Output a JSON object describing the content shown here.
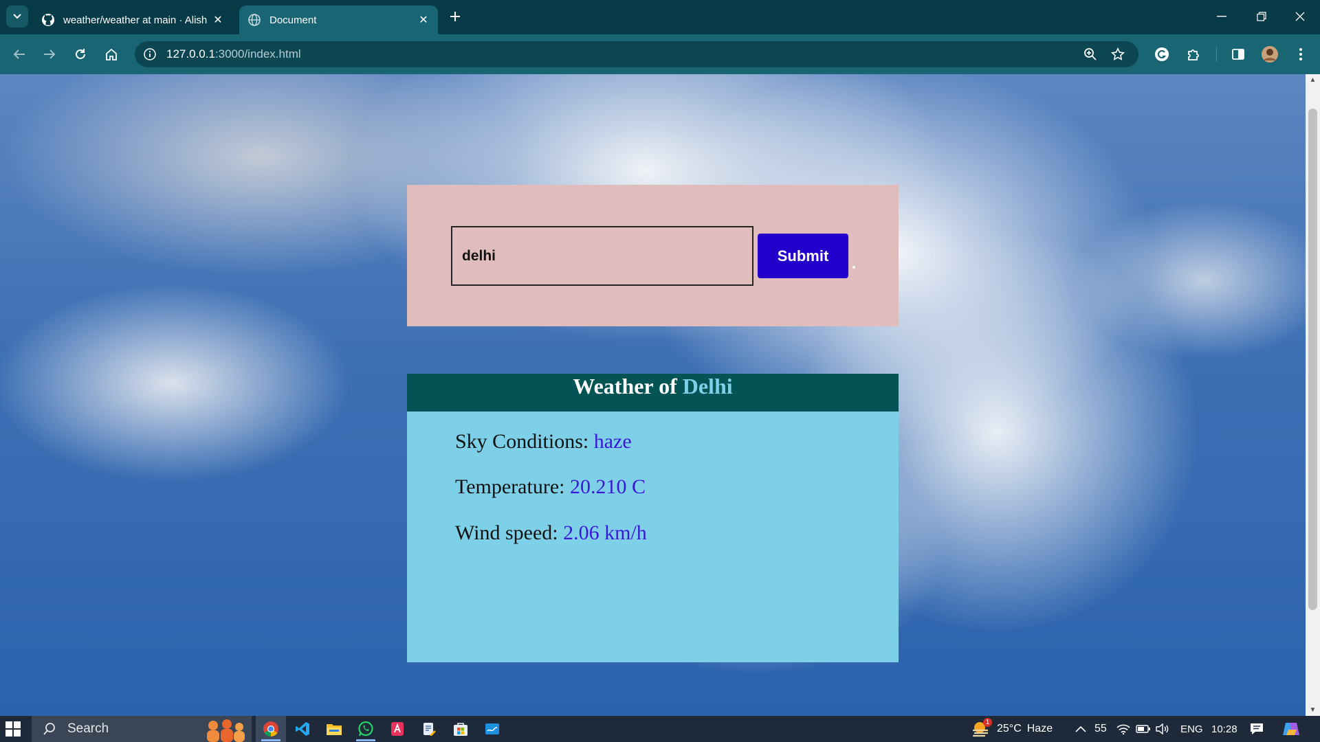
{
  "browser": {
    "tabs": [
      {
        "title": "weather/weather at main · Alish",
        "favicon": "github-icon",
        "active": false
      },
      {
        "title": "Document",
        "favicon": "globe-icon",
        "active": true
      }
    ],
    "address": {
      "host": "127.0.0.1",
      "rest": ":3000/index.html"
    }
  },
  "page": {
    "search": {
      "input_value": "delhi",
      "submit_label": "Submit"
    },
    "weather": {
      "heading_prefix": "Weather of",
      "city": "Delhi",
      "rows": [
        {
          "label": "Sky Conditions:",
          "value": "haze"
        },
        {
          "label": "Temperature:",
          "value": "20.210 C"
        },
        {
          "label": "Wind speed:",
          "value": "2.06 km/h"
        }
      ]
    },
    "colors": {
      "search_card_bg": "#e0bdbc",
      "submit_bg": "#2400cc",
      "weather_header_bg": "#045355",
      "weather_card_bg": "#7ed0e8",
      "value_color": "#3818d8"
    }
  },
  "taskbar": {
    "search_label": "Search",
    "weather": "25°C",
    "weather_condition": "Haze",
    "weather_badge": "1",
    "battery": "55",
    "language": "ENG",
    "time": "10:28"
  }
}
